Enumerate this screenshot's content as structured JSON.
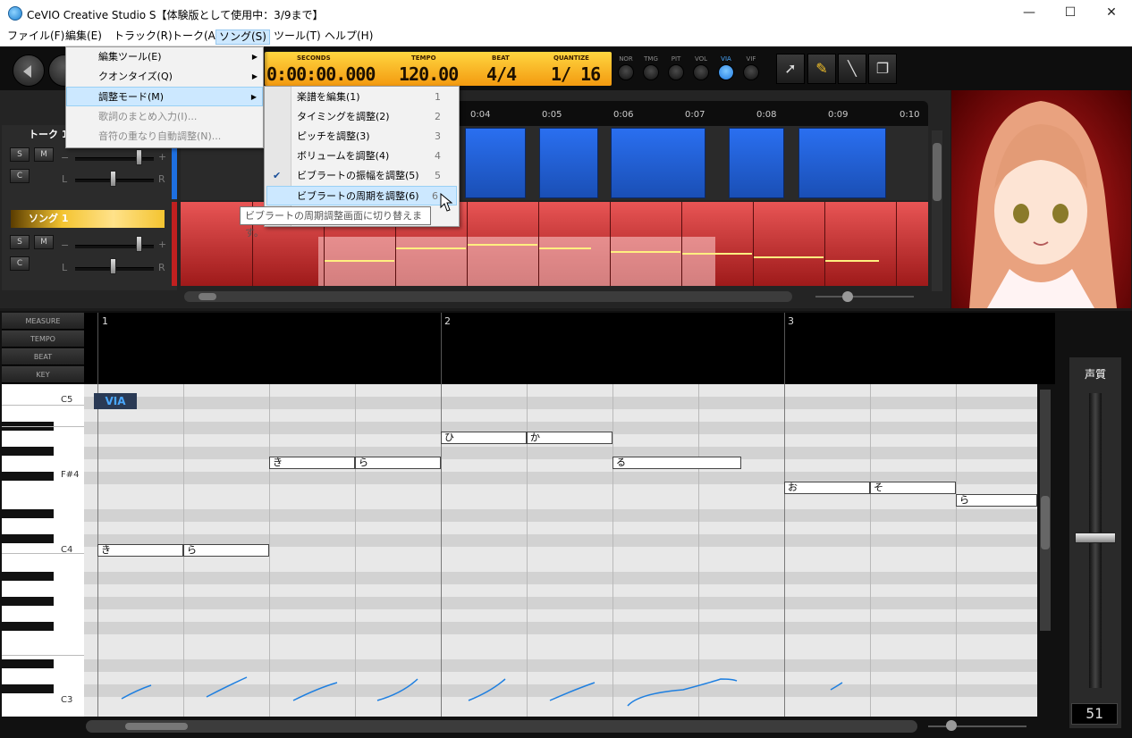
{
  "window": {
    "title": "CeVIO Creative Studio S【体験版として使用中：3/9まで】",
    "minimize": "—",
    "maximize": "☐",
    "close": "✕"
  },
  "menubar": {
    "items": [
      {
        "label": "ファイル(F)"
      },
      {
        "label": "編集(E)"
      },
      {
        "label": "トラック(R)"
      },
      {
        "label": "トーク(A)"
      },
      {
        "label": "ソング(S)"
      },
      {
        "label": "ツール(T)"
      },
      {
        "label": "ヘルプ(H)"
      }
    ]
  },
  "transport": {
    "seconds_label": "SECONDS",
    "seconds": "0:00:00.000",
    "tempo_label": "TEMPO",
    "tempo": "120.00",
    "beat_label": "BEAT",
    "beat": "4/4",
    "quantize_label": "QUANTIZE",
    "quantize": "1/ 16"
  },
  "modes": [
    {
      "label": "NOR"
    },
    {
      "label": "TMG"
    },
    {
      "label": "PIT"
    },
    {
      "label": "VOL"
    },
    {
      "label": "VIA",
      "active": true
    },
    {
      "label": "VIF"
    }
  ],
  "tracks": {
    "talk": {
      "name": "トーク 1"
    },
    "song": {
      "name": "ソング 1"
    },
    "buttons": {
      "solo": "S",
      "mute": "M",
      "other": "C",
      "left": "L",
      "right": "R",
      "plus": "+",
      "minus": "−"
    }
  },
  "ruler": {
    "ticks": [
      "0:04",
      "0:05",
      "0:06",
      "0:07",
      "0:08",
      "0:09",
      "0:10"
    ]
  },
  "editor": {
    "headers": [
      "MEASURE",
      "TEMPO",
      "BEAT",
      "KEY"
    ],
    "measures": [
      "1",
      "2",
      "3"
    ],
    "mode_badge": "VIA",
    "key_labels": [
      "C5",
      "F#4",
      "C4",
      "C3"
    ],
    "notes": [
      {
        "text": "き"
      },
      {
        "text": "ら"
      },
      {
        "text": "き"
      },
      {
        "text": "ら"
      },
      {
        "text": "ひ"
      },
      {
        "text": "か"
      },
      {
        "text": "る"
      },
      {
        "text": "お"
      },
      {
        "text": "そ"
      },
      {
        "text": "ら"
      }
    ]
  },
  "voice_quality": {
    "label": "声質",
    "value": "51"
  },
  "song_menu": {
    "items": [
      {
        "label": "編集ツール(E)",
        "submenu": true
      },
      {
        "label": "クオンタイズ(Q)",
        "submenu": true
      },
      {
        "label": "調整モード(M)",
        "submenu": true,
        "highlight": true
      },
      {
        "label": "歌詞のまとめ入力(I)...",
        "disabled": true
      },
      {
        "label": "音符の重なり自動調整(N)...",
        "disabled": true
      }
    ]
  },
  "adjust_submenu": {
    "items": [
      {
        "label": "楽譜を編集(1)",
        "shortcut": "1"
      },
      {
        "label": "タイミングを調整(2)",
        "shortcut": "2"
      },
      {
        "label": "ピッチを調整(3)",
        "shortcut": "3"
      },
      {
        "label": "ボリュームを調整(4)",
        "shortcut": "4"
      },
      {
        "label": "ビブラートの振幅を調整(5)",
        "shortcut": "5",
        "checked": true
      },
      {
        "label": "ビブラートの周期を調整(6)",
        "shortcut": "6",
        "highlight": true
      }
    ]
  },
  "tooltip": "ビブラートの周期調整画面に切り替えます。"
}
